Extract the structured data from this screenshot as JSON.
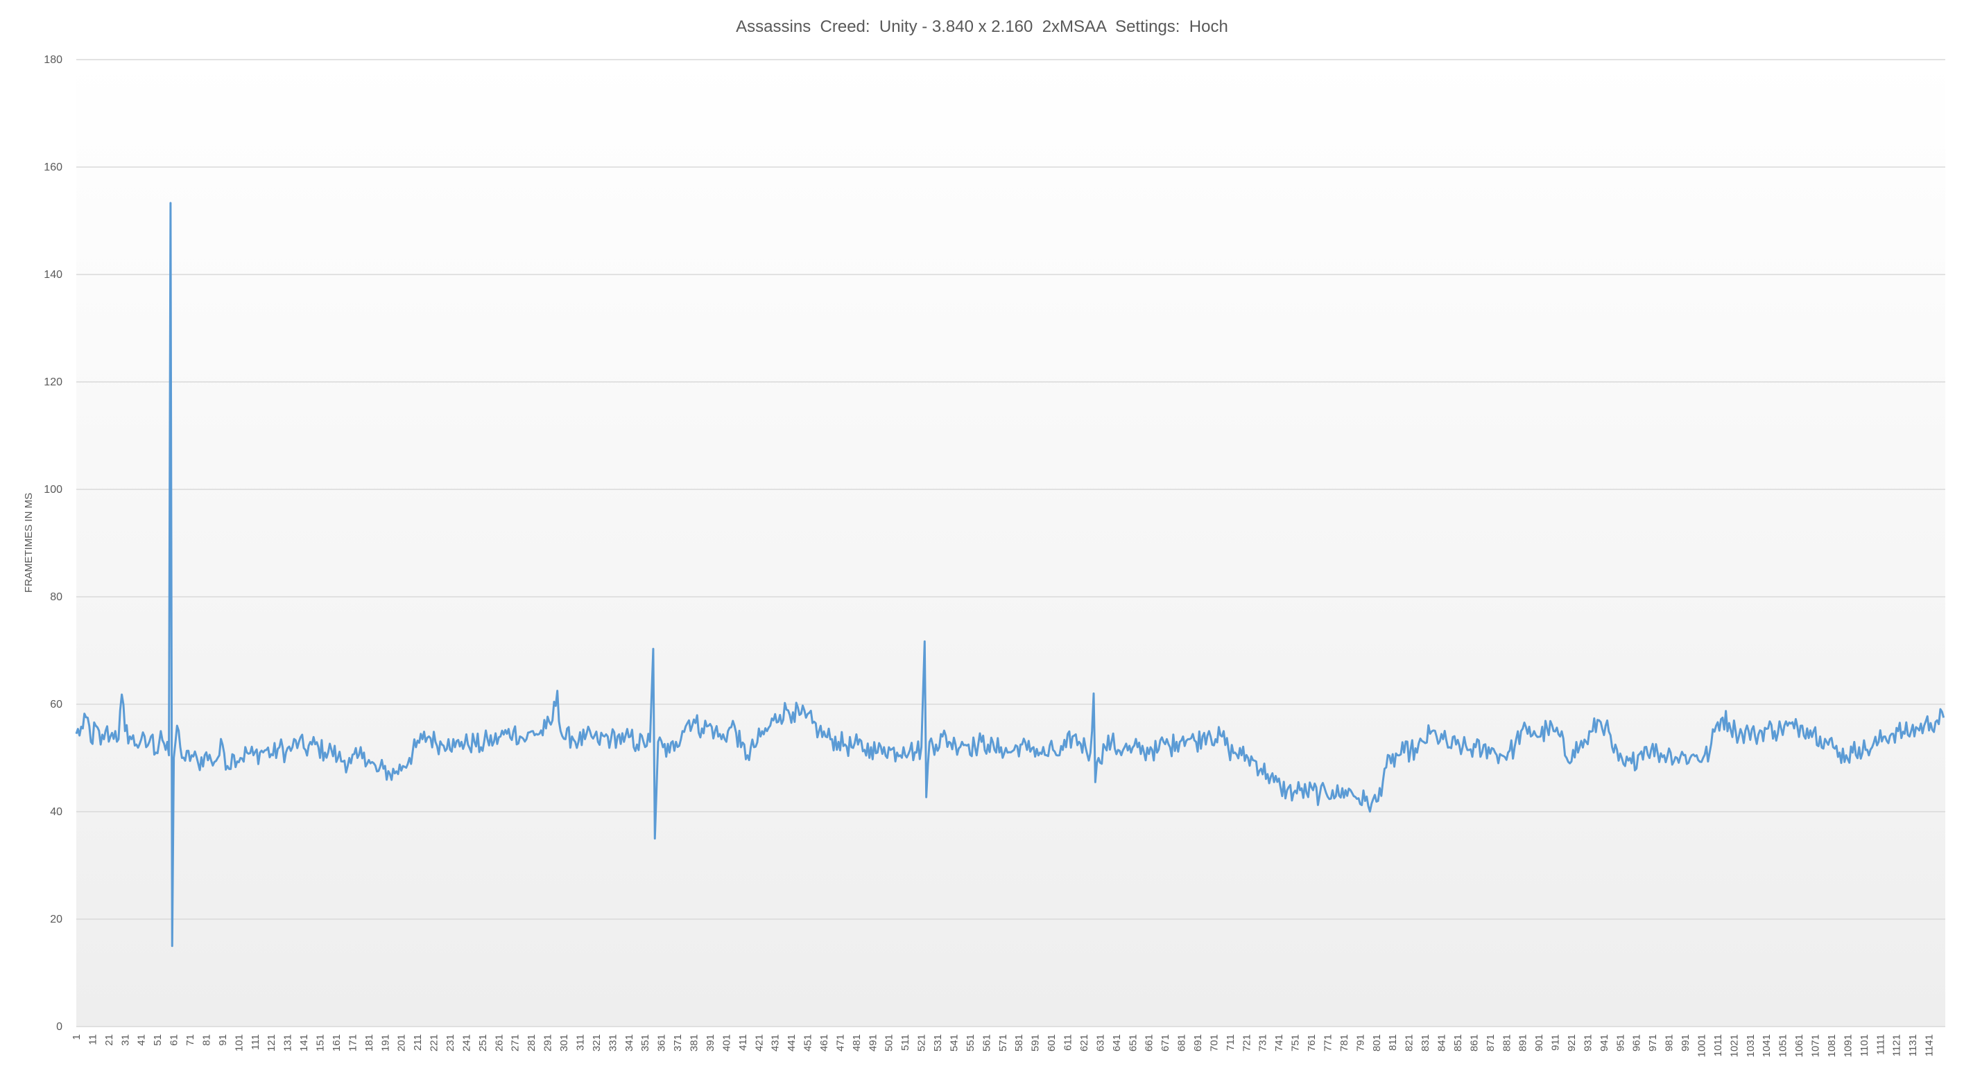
{
  "chart_data": {
    "type": "line",
    "title": "Assassins  Creed:  Unity - 3.840 x 2.160  2xMSAA  Settings:  Hoch",
    "xlabel": "",
    "ylabel": "FRAMETIMES IN MS",
    "ylim": [
      0,
      180
    ],
    "yticks": [
      0,
      20,
      40,
      60,
      80,
      100,
      120,
      140,
      160,
      180
    ],
    "xlim": [
      1,
      1151
    ],
    "xtick_start": 1,
    "xtick_step": 10,
    "xtick_last": 1141,
    "grid": true,
    "legend": "none",
    "colors": {
      "line": "#5b9bd5",
      "grid": "#d9d9d9",
      "text": "#595959"
    },
    "series": [
      {
        "values": [
          [
            1,
            54.5
          ],
          [
            5,
            55.5
          ],
          [
            8,
            57.5
          ],
          [
            10,
            53
          ],
          [
            13,
            56
          ],
          [
            16,
            52.5
          ],
          [
            19,
            55
          ],
          [
            22,
            54
          ],
          [
            25,
            55
          ],
          [
            27,
            53.5
          ],
          [
            29,
            61.8
          ],
          [
            31,
            55
          ],
          [
            34,
            54
          ],
          [
            38,
            52.5
          ],
          [
            41,
            53.5
          ],
          [
            44,
            52
          ],
          [
            47,
            54
          ],
          [
            50,
            51
          ],
          [
            53,
            55
          ],
          [
            56,
            51.5
          ],
          [
            58,
            50.5
          ],
          [
            59,
            153.3
          ],
          [
            60,
            15
          ],
          [
            61,
            50
          ],
          [
            63,
            56
          ],
          [
            65,
            52
          ],
          [
            68,
            49.5
          ],
          [
            72,
            50.5
          ],
          [
            76,
            49
          ],
          [
            80,
            50.5
          ],
          [
            84,
            49.5
          ],
          [
            88,
            50
          ],
          [
            91,
            52.5
          ],
          [
            94,
            48.5
          ],
          [
            98,
            50.5
          ],
          [
            102,
            50
          ],
          [
            106,
            51
          ],
          [
            110,
            50.5
          ],
          [
            114,
            51
          ],
          [
            118,
            51.5
          ],
          [
            122,
            50.5
          ],
          [
            126,
            52
          ],
          [
            130,
            51
          ],
          [
            134,
            52
          ],
          [
            138,
            53
          ],
          [
            142,
            51.5
          ],
          [
            146,
            52.5
          ],
          [
            150,
            52
          ],
          [
            154,
            51
          ],
          [
            158,
            51.5
          ],
          [
            162,
            50
          ],
          [
            166,
            49.5
          ],
          [
            170,
            49
          ],
          [
            174,
            50
          ],
          [
            178,
            51
          ],
          [
            182,
            49
          ],
          [
            186,
            47.5
          ],
          [
            190,
            48
          ],
          [
            194,
            47
          ],
          [
            198,
            47.5
          ],
          [
            202,
            48.5
          ],
          [
            206,
            50
          ],
          [
            210,
            52
          ],
          [
            214,
            53.5
          ],
          [
            218,
            54
          ],
          [
            222,
            53
          ],
          [
            226,
            52.5
          ],
          [
            230,
            53.5
          ],
          [
            234,
            52
          ],
          [
            238,
            53
          ],
          [
            242,
            52.5
          ],
          [
            246,
            53
          ],
          [
            250,
            52
          ],
          [
            254,
            53.5
          ],
          [
            258,
            53
          ],
          [
            262,
            54
          ],
          [
            266,
            54.5
          ],
          [
            270,
            55
          ],
          [
            274,
            54
          ],
          [
            278,
            53.5
          ],
          [
            282,
            55
          ],
          [
            286,
            54.5
          ],
          [
            290,
            55.5
          ],
          [
            294,
            57
          ],
          [
            297,
            62.5
          ],
          [
            299,
            55
          ],
          [
            302,
            53.5
          ],
          [
            306,
            54
          ],
          [
            310,
            53
          ],
          [
            314,
            53.5
          ],
          [
            318,
            54
          ],
          [
            322,
            53
          ],
          [
            326,
            54
          ],
          [
            330,
            53.5
          ],
          [
            334,
            54
          ],
          [
            338,
            53
          ],
          [
            342,
            54
          ],
          [
            346,
            52.5
          ],
          [
            350,
            53
          ],
          [
            354,
            53
          ],
          [
            356,
            70.3
          ],
          [
            357,
            35
          ],
          [
            359,
            53
          ],
          [
            362,
            52
          ],
          [
            366,
            51
          ],
          [
            370,
            53
          ],
          [
            374,
            55
          ],
          [
            378,
            57
          ],
          [
            382,
            56.5
          ],
          [
            386,
            55.5
          ],
          [
            390,
            56
          ],
          [
            394,
            55
          ],
          [
            398,
            53.5
          ],
          [
            402,
            55
          ],
          [
            406,
            56
          ],
          [
            410,
            52
          ],
          [
            414,
            50.5
          ],
          [
            418,
            52
          ],
          [
            422,
            54
          ],
          [
            426,
            55
          ],
          [
            430,
            57
          ],
          [
            434,
            58
          ],
          [
            438,
            59
          ],
          [
            442,
            58.5
          ],
          [
            446,
            58
          ],
          [
            450,
            57.5
          ],
          [
            454,
            56.5
          ],
          [
            458,
            55
          ],
          [
            462,
            54
          ],
          [
            466,
            53.5
          ],
          [
            470,
            53
          ],
          [
            474,
            52.5
          ],
          [
            478,
            52
          ],
          [
            482,
            52.5
          ],
          [
            486,
            51.5
          ],
          [
            490,
            52
          ],
          [
            494,
            51
          ],
          [
            498,
            52
          ],
          [
            502,
            51.5
          ],
          [
            506,
            51
          ],
          [
            510,
            52
          ],
          [
            514,
            51.5
          ],
          [
            518,
            51
          ],
          [
            521,
            52
          ],
          [
            523,
            71.7
          ],
          [
            524,
            42.7
          ],
          [
            526,
            53
          ],
          [
            530,
            52.5
          ],
          [
            534,
            54
          ],
          [
            538,
            53
          ],
          [
            542,
            52.5
          ],
          [
            546,
            53
          ],
          [
            550,
            52.5
          ],
          [
            554,
            52
          ],
          [
            558,
            53
          ],
          [
            562,
            52.5
          ],
          [
            566,
            51.5
          ],
          [
            570,
            52
          ],
          [
            574,
            51
          ],
          [
            578,
            51.5
          ],
          [
            582,
            52.5
          ],
          [
            586,
            51.5
          ],
          [
            590,
            52
          ],
          [
            594,
            51
          ],
          [
            598,
            50.5
          ],
          [
            602,
            51.5
          ],
          [
            606,
            50.5
          ],
          [
            610,
            52
          ],
          [
            614,
            54
          ],
          [
            618,
            53
          ],
          [
            622,
            52
          ],
          [
            625,
            51
          ],
          [
            627,
            62
          ],
          [
            628,
            45.5
          ],
          [
            630,
            50
          ],
          [
            634,
            52
          ],
          [
            638,
            53
          ],
          [
            642,
            51.5
          ],
          [
            646,
            52
          ],
          [
            650,
            51
          ],
          [
            654,
            52
          ],
          [
            658,
            51
          ],
          [
            662,
            52
          ],
          [
            666,
            51
          ],
          [
            670,
            53
          ],
          [
            674,
            52
          ],
          [
            678,
            53
          ],
          [
            682,
            54
          ],
          [
            686,
            53.5
          ],
          [
            690,
            53
          ],
          [
            694,
            54
          ],
          [
            698,
            55
          ],
          [
            702,
            53.5
          ],
          [
            706,
            54
          ],
          [
            710,
            51.5
          ],
          [
            714,
            51
          ],
          [
            718,
            50.5
          ],
          [
            722,
            50
          ],
          [
            726,
            49.5
          ],
          [
            730,
            48
          ],
          [
            734,
            47
          ],
          [
            738,
            45.5
          ],
          [
            742,
            44.5
          ],
          [
            746,
            44
          ],
          [
            750,
            43.5
          ],
          [
            754,
            44
          ],
          [
            758,
            43.5
          ],
          [
            762,
            44
          ],
          [
            766,
            43
          ],
          [
            770,
            43.5
          ],
          [
            774,
            44
          ],
          [
            778,
            43
          ],
          [
            782,
            44
          ],
          [
            786,
            43.5
          ],
          [
            790,
            42.5
          ],
          [
            794,
            42
          ],
          [
            798,
            41.5
          ],
          [
            802,
            42
          ],
          [
            806,
            48
          ],
          [
            810,
            49
          ],
          [
            814,
            50.5
          ],
          [
            818,
            51
          ],
          [
            822,
            51.5
          ],
          [
            826,
            51
          ],
          [
            830,
            53
          ],
          [
            834,
            54.5
          ],
          [
            838,
            54
          ],
          [
            842,
            53.5
          ],
          [
            846,
            52
          ],
          [
            850,
            52.5
          ],
          [
            854,
            52
          ],
          [
            858,
            51.5
          ],
          [
            862,
            52
          ],
          [
            866,
            51
          ],
          [
            870,
            52
          ],
          [
            874,
            51
          ],
          [
            878,
            50.5
          ],
          [
            882,
            51
          ],
          [
            886,
            52
          ],
          [
            890,
            55
          ],
          [
            894,
            54.5
          ],
          [
            898,
            55
          ],
          [
            902,
            54
          ],
          [
            906,
            55.5
          ],
          [
            910,
            55
          ],
          [
            914,
            54
          ],
          [
            918,
            50
          ],
          [
            922,
            51.5
          ],
          [
            926,
            52
          ],
          [
            930,
            53
          ],
          [
            934,
            55
          ],
          [
            938,
            57
          ],
          [
            942,
            56
          ],
          [
            946,
            52
          ],
          [
            950,
            49.5
          ],
          [
            954,
            48.5
          ],
          [
            958,
            49
          ],
          [
            962,
            50.5
          ],
          [
            966,
            52
          ],
          [
            970,
            51.5
          ],
          [
            974,
            51
          ],
          [
            978,
            50.5
          ],
          [
            982,
            51
          ],
          [
            986,
            50
          ],
          [
            990,
            50.5
          ],
          [
            994,
            50
          ],
          [
            998,
            50.5
          ],
          [
            1002,
            50
          ],
          [
            1006,
            51
          ],
          [
            1010,
            56
          ],
          [
            1014,
            57.5
          ],
          [
            1018,
            56.5
          ],
          [
            1022,
            55
          ],
          [
            1026,
            54.5
          ],
          [
            1030,
            55
          ],
          [
            1034,
            54
          ],
          [
            1038,
            55
          ],
          [
            1042,
            55.5
          ],
          [
            1046,
            55
          ],
          [
            1050,
            55.5
          ],
          [
            1054,
            56
          ],
          [
            1058,
            55.5
          ],
          [
            1062,
            56
          ],
          [
            1066,
            55.5
          ],
          [
            1070,
            55
          ],
          [
            1074,
            54
          ],
          [
            1078,
            53
          ],
          [
            1082,
            52
          ],
          [
            1086,
            51
          ],
          [
            1090,
            50.5
          ],
          [
            1094,
            51
          ],
          [
            1098,
            52
          ],
          [
            1102,
            51.5
          ],
          [
            1106,
            52
          ],
          [
            1110,
            53
          ],
          [
            1114,
            54
          ],
          [
            1118,
            54.5
          ],
          [
            1122,
            55
          ],
          [
            1126,
            54.5
          ],
          [
            1130,
            55
          ],
          [
            1134,
            55.5
          ],
          [
            1138,
            56
          ],
          [
            1142,
            56.5
          ],
          [
            1146,
            57
          ],
          [
            1150,
            57.5
          ]
        ]
      }
    ]
  }
}
